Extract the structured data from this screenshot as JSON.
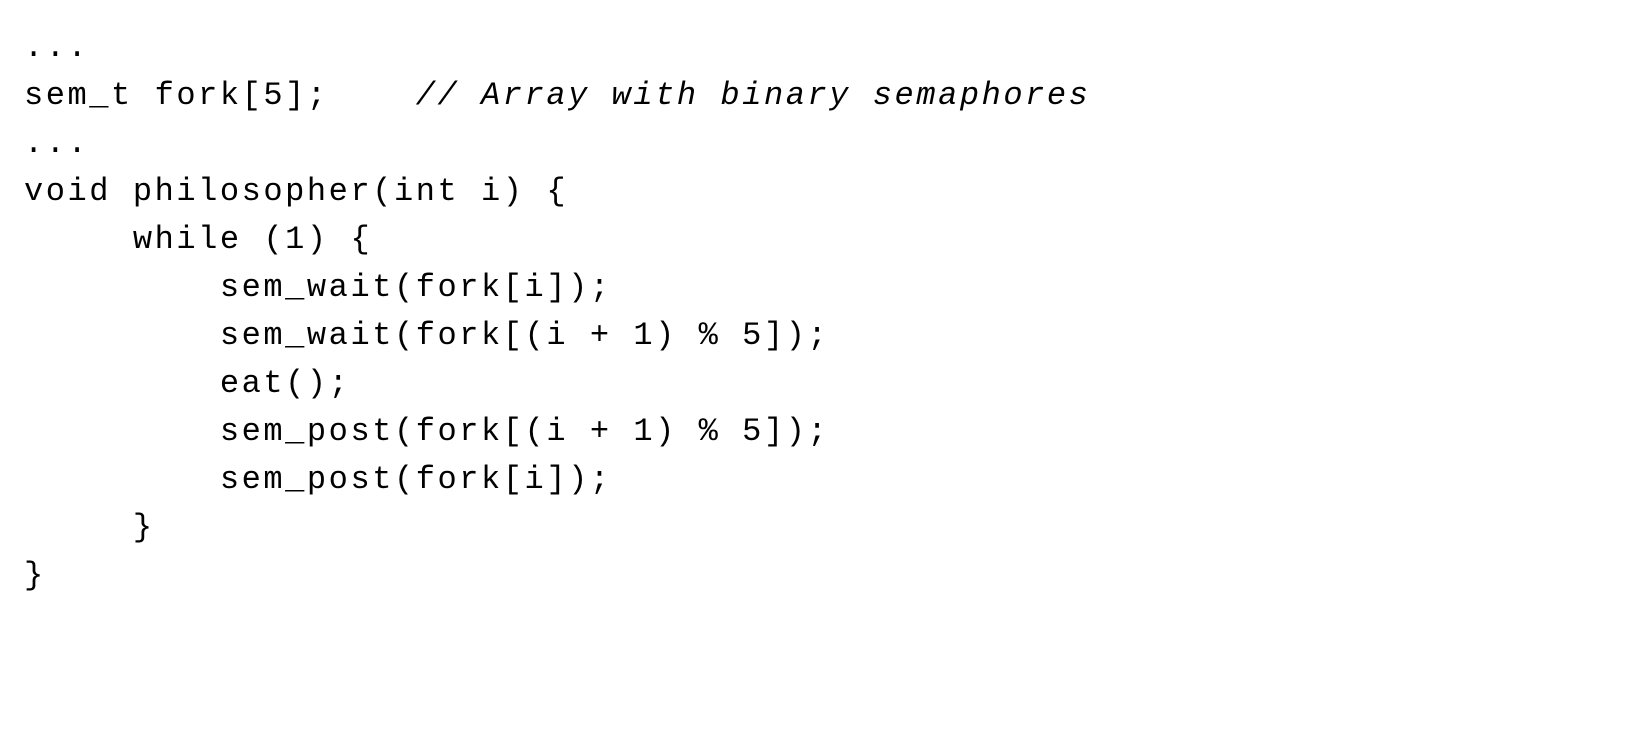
{
  "code": {
    "lines": [
      {
        "text": "...",
        "type": "plain"
      },
      {
        "text": "sem_t fork[5];    ",
        "trailing_comment": "// Array with binary semaphores",
        "type": "with_comment"
      },
      {
        "text": "...",
        "type": "plain"
      },
      {
        "text": "void philosopher(int i) {",
        "type": "plain"
      },
      {
        "text": "     while (1) {",
        "type": "plain"
      },
      {
        "text": "         sem_wait(fork[i]);",
        "type": "plain"
      },
      {
        "text": "         sem_wait(fork[(i + 1) % 5]);",
        "type": "plain"
      },
      {
        "text": "         eat();",
        "type": "plain"
      },
      {
        "text": "         sem_post(fork[(i + 1) % 5]);",
        "type": "plain"
      },
      {
        "text": "         sem_post(fork[i]);",
        "type": "plain"
      },
      {
        "text": "     }",
        "type": "plain"
      },
      {
        "text": "}",
        "type": "plain"
      }
    ]
  }
}
